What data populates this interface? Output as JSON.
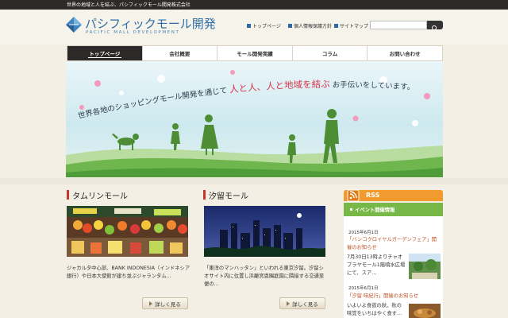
{
  "topbar": {
    "tagline": "世界の地域と人を結ぶ、パシフィックモール開発株式会社"
  },
  "header": {
    "logo_name": "パシフィックモール開発",
    "logo_sub": "PACIFIC MALL DEVELOPMENT",
    "util_links": [
      "トップページ",
      "個人情報保護方針",
      "サイトマップ"
    ],
    "search_placeholder": ""
  },
  "nav": {
    "items": [
      {
        "label": "トップページ",
        "active": true
      },
      {
        "label": "会社概要",
        "active": false
      },
      {
        "label": "モール開発実績",
        "active": false
      },
      {
        "label": "コラム",
        "active": false
      },
      {
        "label": "お問い合わせ",
        "active": false
      }
    ]
  },
  "hero": {
    "copy_part1": "世界各地のショッピングモール開発を通じて",
    "copy_highlight": "人と人、人と地域を結ぶ",
    "copy_part2": "お手伝いをしています。"
  },
  "sections": [
    {
      "title": "タムリンモール",
      "desc": "ジャカルタ中心部、BANK INDONESIA（インドネシア銀行）や日本大使館が建ち並ぶジャランタム…",
      "more": "詳しく見る"
    },
    {
      "title": "汐留モール",
      "desc": "「東洋のマンハッタン」といわれる東京汐留。汐留シオサイト内に位置し浜離宮恩賜庭園に隣接する交通至便の…",
      "more": "詳しく見る"
    }
  ],
  "sidebar": {
    "rss_label": "RSS",
    "events_title": "イベント開催情報",
    "events": [
      {
        "date": "2015年6月1日",
        "title": "「バンコクロイヤルガーデンフェア」開催のお知らせ",
        "body": "7月30日13時よりチャオプラヤモール1階噴水広場にて、スア…"
      },
      {
        "date": "2015年6月1日",
        "title": "「汐留 味紀行」開催のお知らせ",
        "body": "いよいよ食欲の秋、秋の味覚をいちはやく食す…"
      }
    ]
  },
  "colors": {
    "brand": "#2e6fa6",
    "accent": "#c8352a",
    "rss": "#f19a2e",
    "events": "#77b848"
  }
}
